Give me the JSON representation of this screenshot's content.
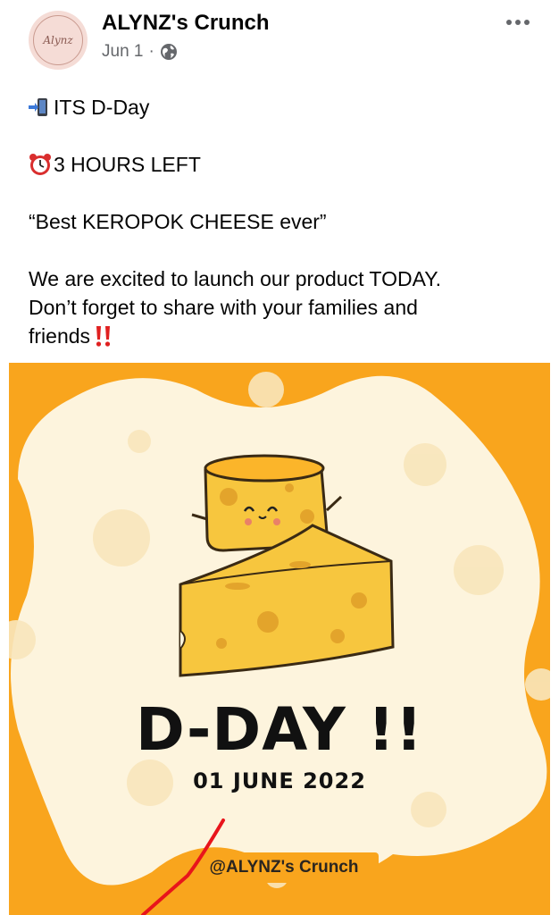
{
  "post": {
    "page_name": "ALYNZ's Crunch",
    "avatar_text": "Alynz",
    "date": "Jun 1",
    "separator": "·",
    "lines": {
      "line1": "ITS D-Day",
      "line2": "3 HOURS LEFT",
      "line3": "“Best KEROPOK CHEESE ever”",
      "line4": "We are excited to launch our product TODAY.",
      "line5": "Don’t forget to share with your families and",
      "line6": "friends"
    }
  },
  "image": {
    "title": "D-DAY !!",
    "date": "01 JUNE 2022",
    "handle": "@ALYNZ's Crunch"
  },
  "colors": {
    "orange": "#f9a51d",
    "cream": "#fdf4dd",
    "cheese": "#f7c63e",
    "annotation": "#e8141b"
  },
  "icons": [
    "more-options-icon",
    "globe-icon",
    "mobile-arrow-emoji-icon",
    "alarm-clock-emoji-icon",
    "double-exclamation-emoji-icon"
  ]
}
